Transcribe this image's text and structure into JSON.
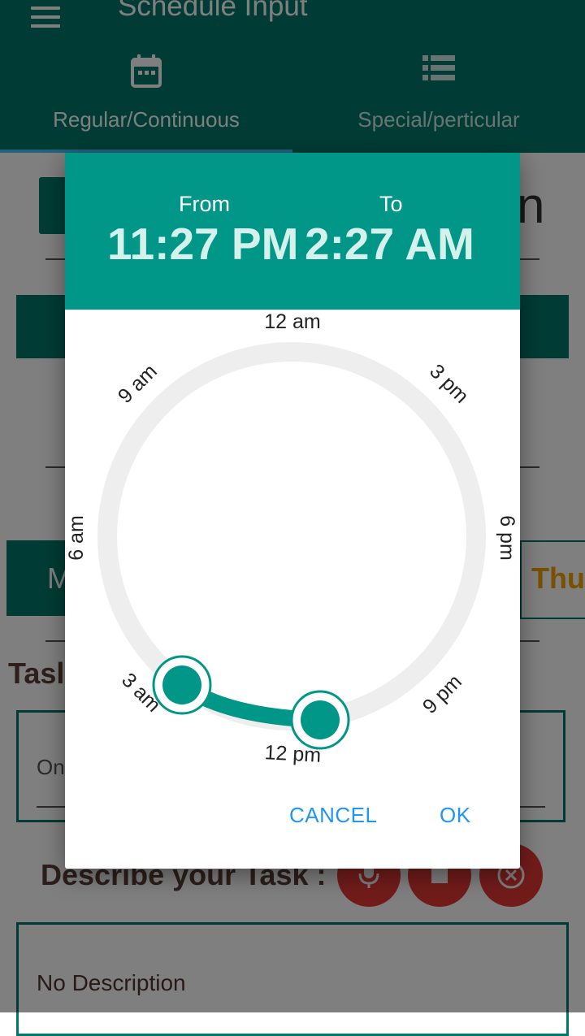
{
  "app": {
    "title": "Schedule Input"
  },
  "tabs": [
    {
      "label": "Regular/Continuous",
      "icon": "calendar-icon",
      "selected": true
    },
    {
      "label": "Special/perticular",
      "icon": "list-icon",
      "selected": false
    }
  ],
  "background": {
    "partial_heading_right": "n",
    "day_left_partial": "M",
    "day_right_partial": "Thu",
    "task_label_partial": "Tasl",
    "task_value_partial": "On",
    "describe_label": "Describe your Task :",
    "description_value": "No Description"
  },
  "dialog": {
    "from_label": "From",
    "to_label": "To",
    "from_time": "11:27 PM",
    "to_time": "2:27 AM",
    "dial_labels": {
      "top": "12 am",
      "top_right": "3 pm",
      "right": "6 pm",
      "bottom_right": "9 pm",
      "bottom": "12 pm",
      "bottom_left": "3 am",
      "left": "6 am",
      "top_left": "9 am"
    },
    "cancel_label": "CANCEL",
    "ok_label": "OK"
  },
  "colors": {
    "primary": "#00796b",
    "accent": "#009688",
    "button_text": "#2196f3",
    "fab": "#e53935",
    "dial_track": "#eeeeee"
  }
}
